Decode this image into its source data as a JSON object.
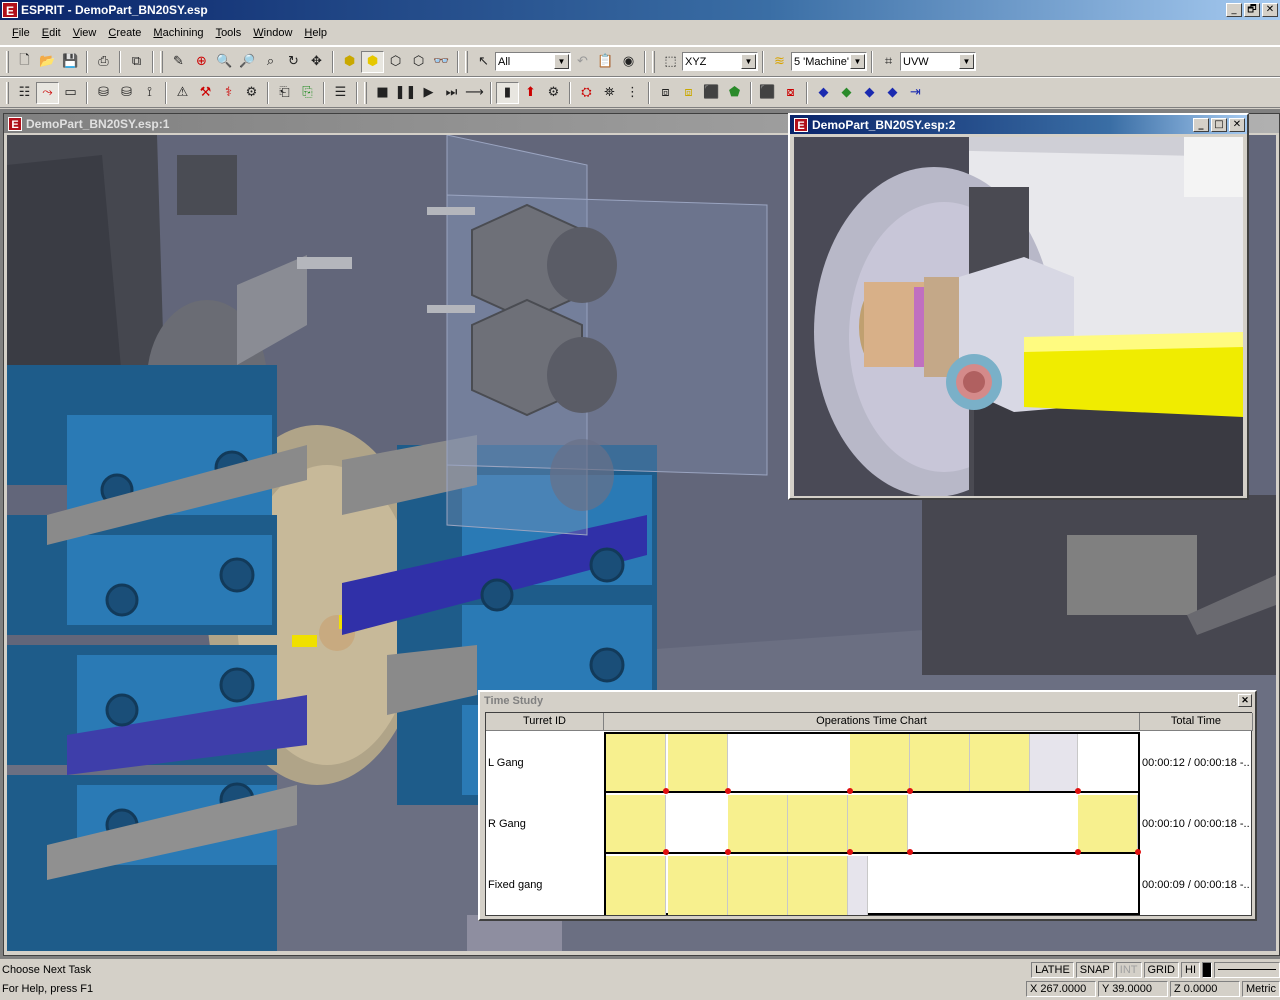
{
  "window": {
    "title": "ESPRIT - DemoPart_BN20SY.esp",
    "app_icon": "E",
    "min": "_",
    "max": "🗗",
    "close": "✕"
  },
  "menu": [
    "File",
    "Edit",
    "View",
    "Create",
    "Machining",
    "Tools",
    "Window",
    "Help"
  ],
  "toolbar1": {
    "combo_filter": "All",
    "combo_plane": "XYZ",
    "combo_layer": "5 'Machine'",
    "combo_workplane": "UVW"
  },
  "child1": {
    "title": "DemoPart_BN20SY.esp:1"
  },
  "child2": {
    "title": "DemoPart_BN20SY.esp:2"
  },
  "timestudy": {
    "title": "Time Study",
    "headers": [
      "Turret ID",
      "Operations Time Chart",
      "Total Time"
    ],
    "rows": [
      {
        "label": "L Gang",
        "total": "00:00:12 / 00:00:18 -..."
      },
      {
        "label": "R Gang",
        "total": "00:00:10 / 00:00:18 -..."
      },
      {
        "label": "Fixed gang",
        "total": "00:00:09 / 00:00:18 -..."
      }
    ]
  },
  "status": {
    "task": "Choose Next Task",
    "help": "For Help, press F1",
    "flags": [
      "LATHE",
      "SNAP",
      "INT",
      "GRID",
      "HI"
    ],
    "x": "X 267.0000",
    "y": "Y 39.0000",
    "z": "Z 0.0000",
    "units": "Metric"
  }
}
